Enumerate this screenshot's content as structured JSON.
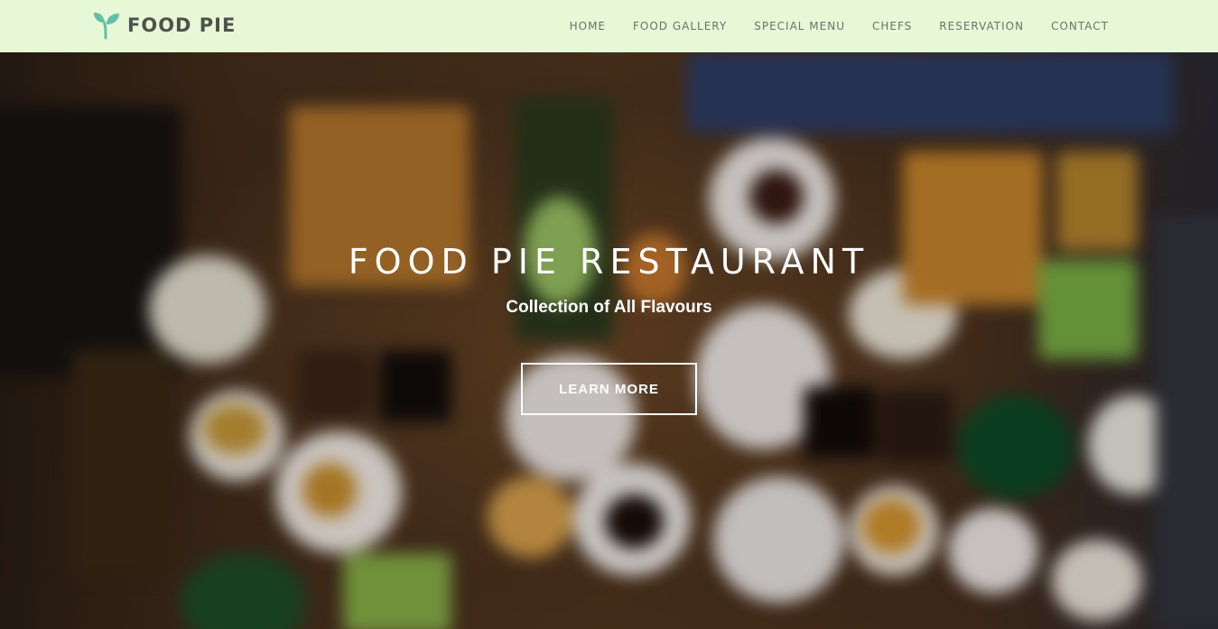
{
  "header": {
    "brand": "FOOD PIE",
    "logo_icon": "sprout-icon",
    "logo_color": "#5fc0a8",
    "nav": [
      {
        "label": "HOME"
      },
      {
        "label": "FOOD GALLERY"
      },
      {
        "label": "SPECIAL MENU"
      },
      {
        "label": "CHEFS"
      },
      {
        "label": "RESERVATION"
      },
      {
        "label": "CONTACT"
      }
    ],
    "background": "#e6f8d6"
  },
  "hero": {
    "title": "FOOD PIE RESTAURANT",
    "subtitle": "Collection of All Flavours",
    "button_label": "LEARN MORE"
  }
}
